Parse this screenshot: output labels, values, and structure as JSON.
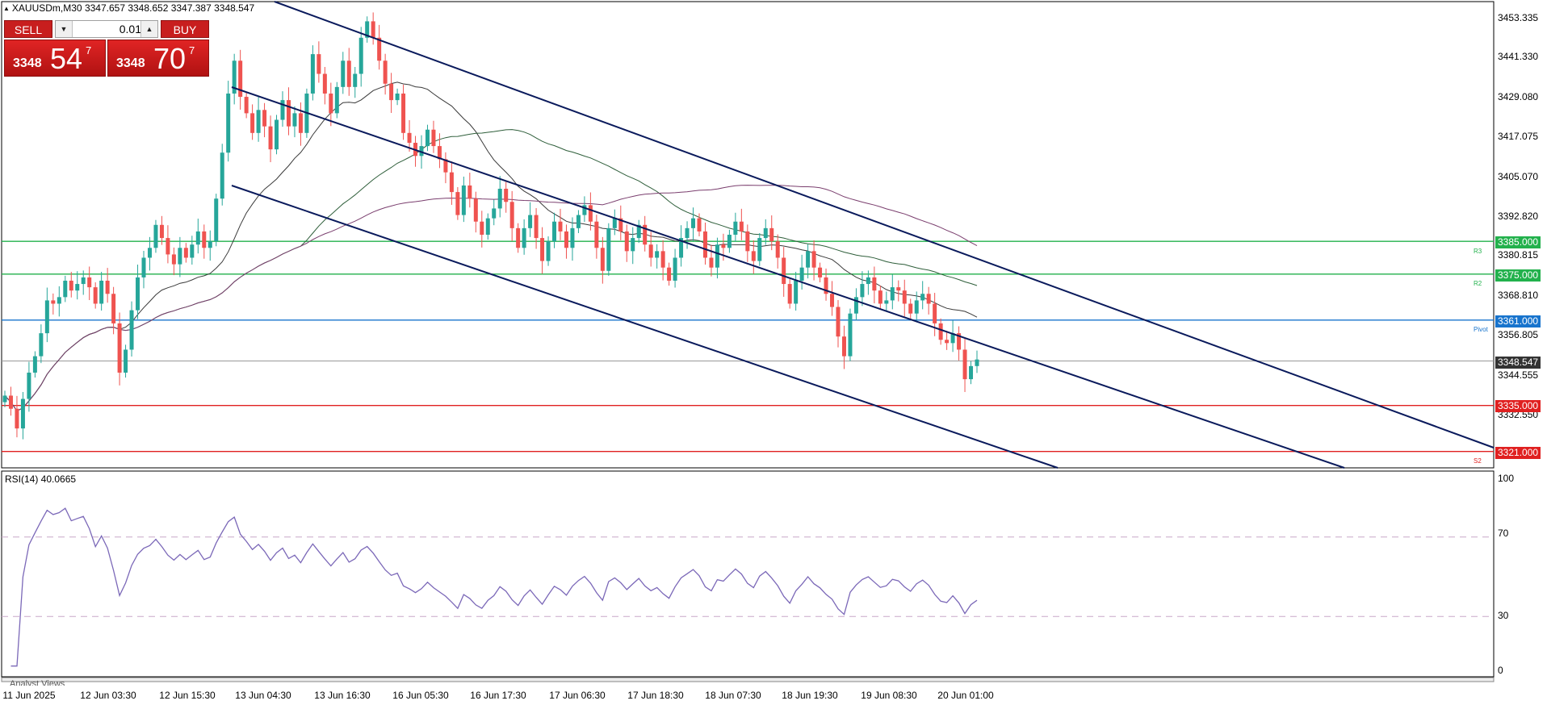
{
  "header": {
    "title": "XAUUSDm,M30  3347.657 3348.652 3347.387 3348.547"
  },
  "trade_panel": {
    "sell_label": "SELL",
    "buy_label": "BUY",
    "lot_value": "0.01",
    "sell_price": {
      "prefix": "3348",
      "big": "54",
      "sup": "7"
    },
    "buy_price": {
      "prefix": "3348",
      "big": "70",
      "sup": "7"
    }
  },
  "price_axis": {
    "ticks": [
      "3453.335",
      "3441.330",
      "3429.080",
      "3417.075",
      "3405.070",
      "3392.820",
      "3380.815",
      "3368.810",
      "3356.805",
      "3344.555",
      "3332.550"
    ]
  },
  "levels": [
    {
      "price": 3385.0,
      "label": "3385.000",
      "color": "#22b14c",
      "name": "R3"
    },
    {
      "price": 3375.0,
      "label": "3375.000",
      "color": "#22b14c",
      "name": "R2"
    },
    {
      "price": 3361.0,
      "label": "3361.000",
      "color": "#1874cd",
      "name": "Pivot"
    },
    {
      "price": 3335.0,
      "label": "3335.000",
      "color": "#e02020",
      "name": ""
    },
    {
      "price": 3321.0,
      "label": "3321.000",
      "color": "#e02020",
      "name": "S2"
    }
  ],
  "current_price": {
    "value": 3348.547,
    "label": "3348.547",
    "color": "#333333"
  },
  "rsi": {
    "label": "RSI(14) 40.0665",
    "ticks": [
      "100",
      "70",
      "30",
      "0"
    ],
    "color": "#7b68b8"
  },
  "time_axis": {
    "labels": [
      "11 Jun 2025",
      "12 Jun 03:30",
      "12 Jun 15:30",
      "13 Jun 04:30",
      "13 Jun 16:30",
      "16 Jun 05:30",
      "16 Jun 17:30",
      "17 Jun 06:30",
      "17 Jun 18:30",
      "18 Jun 07:30",
      "18 Jun 19:30",
      "19 Jun 08:30",
      "20 Jun 01:00"
    ]
  },
  "analyst_tab": "Analyst Views",
  "colors": {
    "bull": "#26a69a",
    "bear": "#ef5350",
    "channel": "#0a1a5c"
  },
  "chart_data": {
    "type": "candlestick",
    "symbol": "XAUUSDm",
    "timeframe": "M30",
    "ylim": [
      3316,
      3458
    ],
    "close": [
      3338,
      3334,
      3328,
      3337,
      3345,
      3350,
      3357,
      3367,
      3366,
      3368,
      3373,
      3370,
      3372,
      3374,
      3371,
      3366,
      3373,
      3369,
      3360,
      3345,
      3352,
      3364,
      3374,
      3380,
      3383,
      3390,
      3386,
      3381,
      3378,
      3383,
      3380,
      3384,
      3388,
      3383,
      3385,
      3398,
      3412,
      3430,
      3440,
      3429,
      3424,
      3418,
      3425,
      3420,
      3413,
      3422,
      3428,
      3420,
      3424,
      3418,
      3430,
      3442,
      3436,
      3430,
      3424,
      3432,
      3440,
      3432,
      3436,
      3447,
      3452,
      3447,
      3440,
      3433,
      3428,
      3430,
      3418,
      3415,
      3411,
      3414,
      3419,
      3414,
      3410,
      3406,
      3400,
      3393,
      3402,
      3398,
      3391,
      3387,
      3392,
      3395,
      3401,
      3397,
      3389,
      3383,
      3389,
      3393,
      3386,
      3379,
      3385,
      3391,
      3388,
      3383,
      3389,
      3393,
      3396,
      3391,
      3383,
      3376,
      3389,
      3392,
      3388,
      3382,
      3386,
      3390,
      3384,
      3380,
      3382,
      3377,
      3373,
      3380,
      3386,
      3389,
      3392,
      3388,
      3380,
      3377,
      3384,
      3383,
      3387,
      3391,
      3388,
      3382,
      3379,
      3386,
      3389,
      3385,
      3380,
      3372,
      3366,
      3373,
      3377,
      3382,
      3377,
      3374,
      3369,
      3365,
      3356,
      3350,
      3363,
      3368,
      3372,
      3374,
      3370,
      3366,
      3367,
      3371,
      3370,
      3366,
      3363,
      3367,
      3369,
      3366,
      3360,
      3355,
      3354,
      3357,
      3352,
      3343,
      3347,
      3349
    ]
  }
}
